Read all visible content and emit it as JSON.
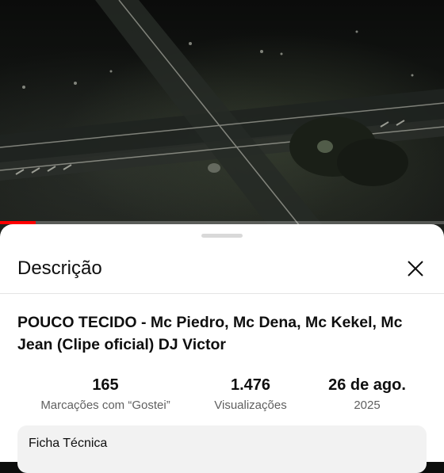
{
  "video": {
    "progress_fraction": 0.08,
    "progress_color": "#ff0000"
  },
  "sheet": {
    "title": "Descrição",
    "close_icon": "close-icon"
  },
  "video_info": {
    "title": "POUCO TECIDO - Mc Piedro, Mc Dena, Mc Kekel, Mc Jean (Clipe oficial) DJ Victor",
    "stats": [
      {
        "value": "165",
        "label": "Marcações com “Gostei”"
      },
      {
        "value": "1.476",
        "label": "Visualizações"
      },
      {
        "value": "26 de ago.",
        "label": "2025"
      }
    ]
  },
  "card": {
    "label": "Ficha Técnica"
  }
}
